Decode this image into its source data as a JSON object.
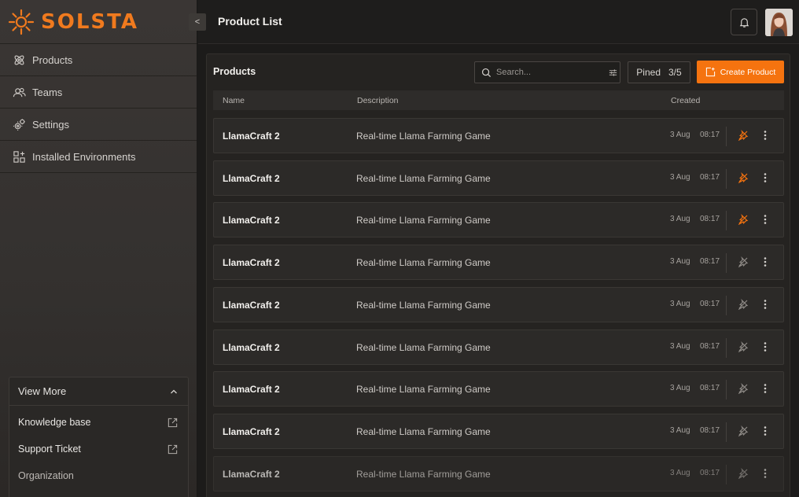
{
  "brand": {
    "name": "SOLSTA",
    "accent": "#f5730f"
  },
  "sidebar": {
    "items": [
      {
        "label": "Products",
        "icon": "atom-icon"
      },
      {
        "label": "Teams",
        "icon": "users-icon"
      },
      {
        "label": "Settings",
        "icon": "gears-icon"
      },
      {
        "label": "Installed Environments",
        "icon": "grid-plus-icon"
      }
    ],
    "view_more": {
      "label": "View More",
      "items": [
        {
          "label": "Knowledge base"
        },
        {
          "label": "Support Ticket"
        },
        {
          "label": "Organization"
        }
      ]
    }
  },
  "collapse_label": "<",
  "header": {
    "title": "Product List"
  },
  "panel": {
    "title": "Products",
    "search_placeholder": "Search...",
    "pined_label": "Pined",
    "pined_count": "3/5",
    "create_label": "Create Product",
    "columns": {
      "name": "Name",
      "description": "Description",
      "created": "Created"
    },
    "rows": [
      {
        "name": "LlamaCraft 2",
        "description": "Real-time Llama Farming Game",
        "date": "3 Aug",
        "time": "08:17",
        "pinned": true
      },
      {
        "name": "LlamaCraft 2",
        "description": "Real-time Llama Farming Game",
        "date": "3 Aug",
        "time": "08:17",
        "pinned": true
      },
      {
        "name": "LlamaCraft 2",
        "description": "Real-time Llama Farming Game",
        "date": "3 Aug",
        "time": "08:17",
        "pinned": true
      },
      {
        "name": "LlamaCraft 2",
        "description": "Real-time Llama Farming Game",
        "date": "3 Aug",
        "time": "08:17",
        "pinned": false
      },
      {
        "name": "LlamaCraft 2",
        "description": "Real-time Llama Farming Game",
        "date": "3 Aug",
        "time": "08:17",
        "pinned": false
      },
      {
        "name": "LlamaCraft 2",
        "description": "Real-time Llama Farming Game",
        "date": "3 Aug",
        "time": "08:17",
        "pinned": false
      },
      {
        "name": "LlamaCraft 2",
        "description": "Real-time Llama Farming Game",
        "date": "3 Aug",
        "time": "08:17",
        "pinned": false
      },
      {
        "name": "LlamaCraft 2",
        "description": "Real-time Llama Farming Game",
        "date": "3 Aug",
        "time": "08:17",
        "pinned": false
      },
      {
        "name": "LlamaCraft 2",
        "description": "Real-time Llama Farming Game",
        "date": "3 Aug",
        "time": "08:17",
        "pinned": false
      }
    ]
  }
}
